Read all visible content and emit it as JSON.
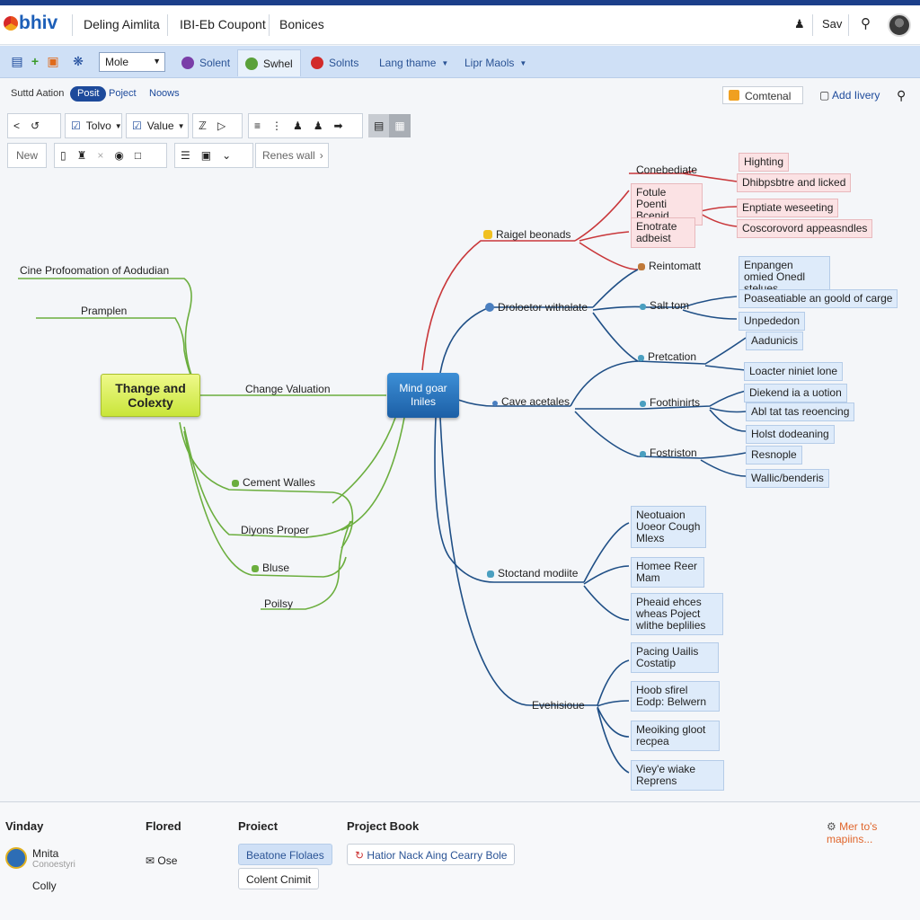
{
  "app": {
    "logo": "bhiv",
    "nav": [
      "Deling Aimlita",
      "IBI-Eb Coupont",
      "Bonices"
    ],
    "user_label": "Sav"
  },
  "ribbon": {
    "mode_value": "Mole",
    "tabs": [
      "Solent",
      "Swhel",
      "Solnts",
      "Lang thame",
      "Lipr Maols"
    ]
  },
  "subbar": {
    "label": "Suttd Aation",
    "pill": "Posit",
    "links": [
      "Poject",
      "Noows"
    ],
    "content_button": "Comtenal",
    "add_theory": "Add Iivery"
  },
  "toolbar": {
    "row1": {
      "tolvo": "Tolvo",
      "value": "Value"
    },
    "row2": {
      "new": "New",
      "renes_wall": "Renes wall"
    }
  },
  "mindmap": {
    "center": "Mind goar Iniles",
    "left_main": "Thange and Colexty",
    "left_branches": [
      "Cine Profoomation of Aodudian",
      "Pramplen",
      "Change Valuation",
      "Cement Walles",
      "Diyons Proper",
      "Bluse",
      "Poilsy"
    ],
    "right_topics": {
      "raigel": "Raigel beonads",
      "drolietor": "Droloetor withalate",
      "cave": "Cave acetales",
      "stoctand": "Stoctand modiite",
      "evehisioue": "Evehisioue"
    },
    "sub_labels": {
      "conebediate": "Conebediate",
      "reintomatt": "Reintomatt",
      "salttom": "Salt tom",
      "pretcation": "Pretcation",
      "foothinirts": "Foothinirts",
      "fostriston": "Fostriston"
    },
    "red_boxes": [
      "Highting",
      "Dhibpsbtre and licked",
      "Fotule Poenti Bcenid",
      "Enptiate weseeting",
      "Enotrate adbeist",
      "Coscorovord appeasndles"
    ],
    "blue_right": [
      "Enpangen omied Onedl stelues",
      "Poaseatiable an goold of carge",
      "Unpededon",
      "Aadunicis",
      "Loacter niniet lone",
      "Diekend ia a uotion",
      "Abl tat tas reoencing",
      "Holst dodeaning",
      "Resnople",
      "Wallic/benderis"
    ],
    "blue_lower": [
      "Neotuaion Uoeor Cough Mlexs",
      "Homee Reer Mam",
      "Pheaid ehces wheas Poject wlithe beplilies",
      "Pacing Uailis Costatip",
      "Hoob sfirel Eodp: Belwern",
      "Meoiking gloot recpea",
      "Viey'e wiake Reprens"
    ]
  },
  "footer": {
    "headings": [
      "Vinday",
      "Flored",
      "Proiect",
      "Project Book"
    ],
    "person_name": "Mnita",
    "person_sub": "Conoestyri",
    "colly": "Colly",
    "ose": "Ose",
    "btn_blue": "Beatone Flolaes",
    "btn_white": "Colent Cnimit",
    "project_link": "Hatior Nack Aing Cearry Bole",
    "more": "Mer to's mapiins..."
  }
}
